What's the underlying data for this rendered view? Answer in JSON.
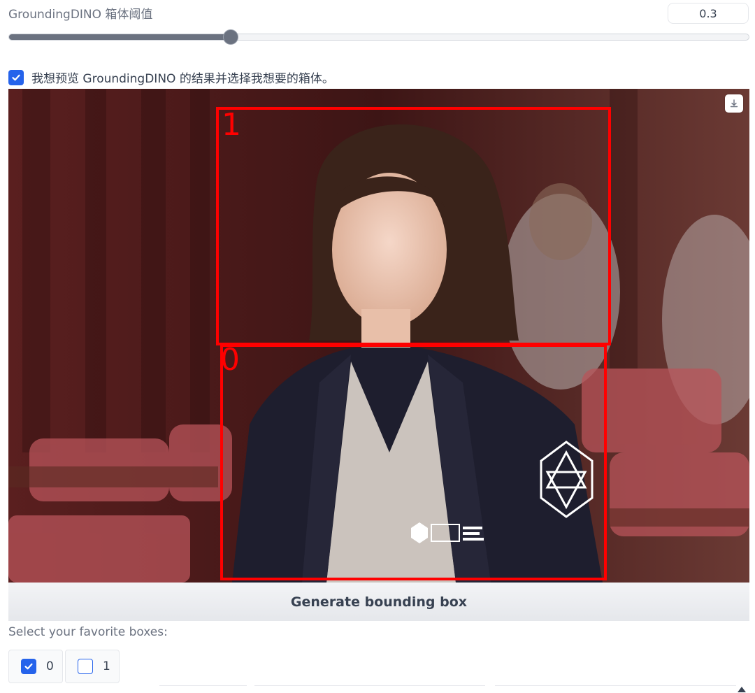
{
  "threshold": {
    "label": "GroundingDINO 箱体阈值",
    "value": "0.3",
    "fraction": 0.3
  },
  "preview": {
    "label": "我想预览 GroundingDINO 的结果并选择我想要的箱体。",
    "checked": true
  },
  "image": {
    "boxes": [
      {
        "label": "1"
      },
      {
        "label": "0"
      }
    ],
    "download_icon": "download-icon",
    "box_color": "#ff0000"
  },
  "generate_button": {
    "label": "Generate bounding box"
  },
  "favorites": {
    "label": "Select your favorite boxes:",
    "options": [
      {
        "label": "0",
        "checked": true
      },
      {
        "label": "1",
        "checked": false
      }
    ]
  },
  "colors": {
    "accent": "#2563eb",
    "slider": "#6b7280"
  }
}
